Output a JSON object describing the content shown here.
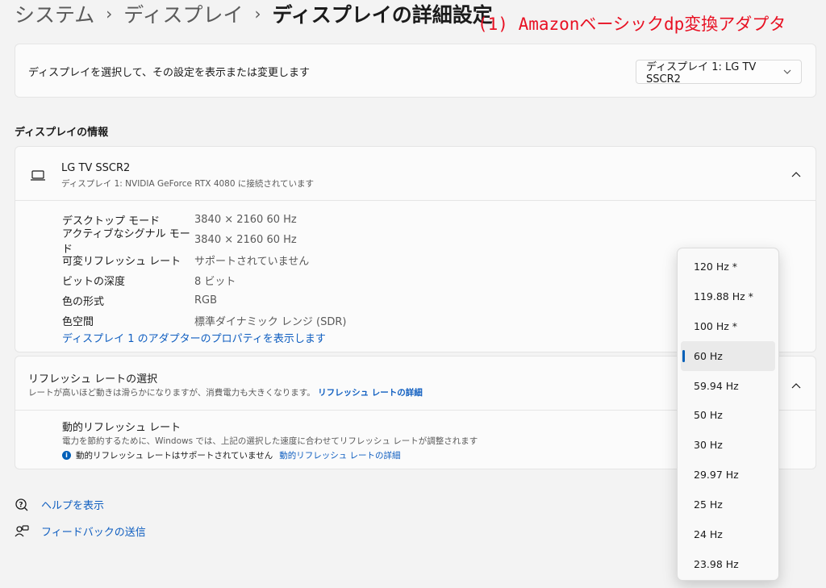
{
  "header": {
    "breadcrumb": [
      "システム",
      "ディスプレイ"
    ],
    "current": "ディスプレイの詳細設定",
    "separator": "›",
    "annotation": "(1) Amazonベーシックdp変換アダプタ"
  },
  "select_display": {
    "description": "ディスプレイを選択して、その設定を表示または変更します",
    "selected": "ディスプレイ 1: LG TV SSCR2"
  },
  "display_info": {
    "section_title": "ディスプレイの情報",
    "name": "LG TV SSCR2",
    "subtitle": "ディスプレイ 1: NVIDIA GeForce RTX 4080 に接続されています",
    "properties": [
      {
        "label": "デスクトップ モード",
        "value": "3840 × 2160 60 Hz"
      },
      {
        "label": "アクティブなシグナル モード",
        "value": "3840 × 2160 60 Hz"
      },
      {
        "label": "可変リフレッシュ レート",
        "value": "サポートされていません"
      },
      {
        "label": "ビットの深度",
        "value": "8 ビット"
      },
      {
        "label": "色の形式",
        "value": "RGB"
      },
      {
        "label": "色空間",
        "value": "標準ダイナミック レンジ (SDR)"
      }
    ],
    "adapter_link": "ディスプレイ 1 のアダプターのプロパティを表示します"
  },
  "refresh_rate": {
    "title": "リフレッシュ レートの選択",
    "subtitle": "レートが高いほど動きは滑らかになりますが、消費電力も大きくなります。",
    "subtitle_link": "リフレッシュ レートの詳細",
    "dynamic_title": "動的リフレッシュ レート",
    "dynamic_subtitle": "電力を節約するために、Windows では、上記の選択した速度に合わせてリフレッシュ レートが調整されます",
    "dynamic_info": "動的リフレッシュ レートはサポートされていません",
    "dynamic_link": "動的リフレッシュ レートの詳細",
    "options": [
      "120 Hz *",
      "119.88 Hz *",
      "100 Hz *",
      "60 Hz",
      "59.94 Hz",
      "50 Hz",
      "30 Hz",
      "29.97 Hz",
      "25 Hz",
      "24 Hz",
      "23.98 Hz"
    ],
    "selected": "60 Hz"
  },
  "footer": {
    "help": "ヘルプを表示",
    "feedback": "フィードバックの送信"
  },
  "colors": {
    "accent": "#005fb8",
    "link": "#0f5ec0",
    "annotation": "#e81123"
  }
}
